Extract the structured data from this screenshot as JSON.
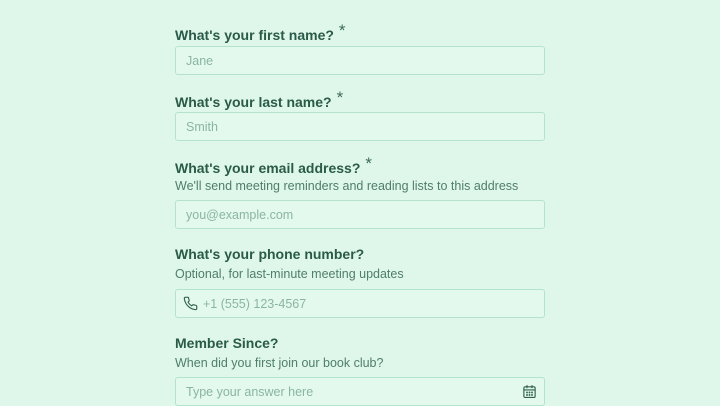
{
  "form": {
    "first_name": {
      "label": "What's your first name?",
      "required_mark": "*",
      "placeholder": "Jane"
    },
    "last_name": {
      "label": "What's your last name?",
      "required_mark": "*",
      "placeholder": "Smith"
    },
    "email": {
      "label": "What's your email address?",
      "required_mark": "*",
      "helper": "We'll send meeting reminders and reading lists to this address",
      "placeholder": "you@example.com"
    },
    "phone": {
      "label": "What's your phone number?",
      "helper": "Optional, for last-minute meeting updates",
      "placeholder": "+1 (555) 123-4567",
      "icon": "phone-icon"
    },
    "member_since": {
      "label": "Member Since?",
      "helper": "When did you first join our book club?",
      "placeholder": "Type your answer here",
      "icon": "calendar-icon"
    }
  },
  "colors": {
    "background": "#dff7ea",
    "label_text": "#2a5a48",
    "helper_text": "#4f7e6b",
    "placeholder_text": "#8bb5a2",
    "field_border": "#b4e3cb"
  }
}
